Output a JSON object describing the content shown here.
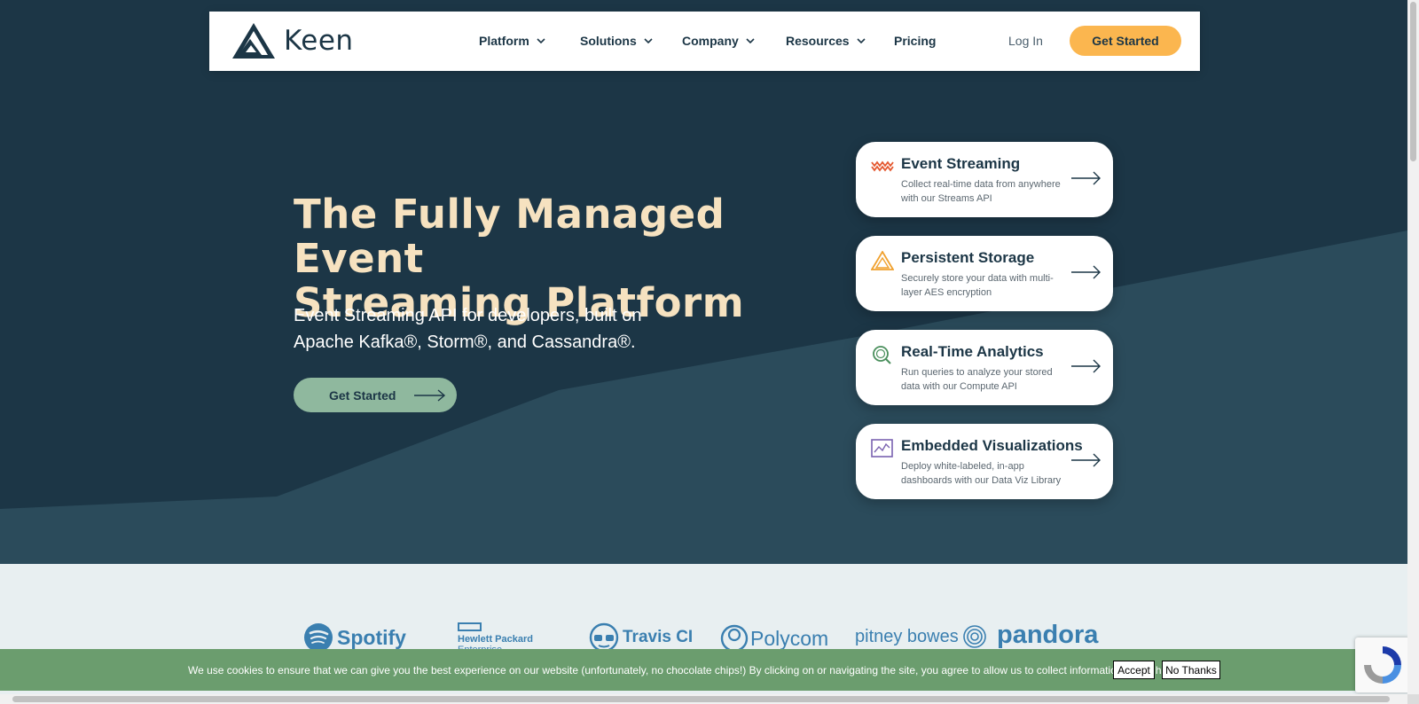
{
  "brand": {
    "name": "Keen",
    "logo_color": "#1c3646"
  },
  "nav": {
    "items": [
      {
        "label": "Platform",
        "has_dropdown": true
      },
      {
        "label": "Solutions",
        "has_dropdown": true
      },
      {
        "label": "Company",
        "has_dropdown": true
      },
      {
        "label": "Resources",
        "has_dropdown": true
      },
      {
        "label": "Pricing",
        "has_dropdown": false
      }
    ],
    "login_label": "Log In",
    "cta_label": "Get Started"
  },
  "hero": {
    "title_line1": "The Fully Managed Event",
    "title_line2": "Streaming Platform",
    "subtitle_line1": "Event Streaming API for developers, built on",
    "subtitle_line2": "Apache Kafka®, Storm®, and Cassandra®.",
    "cta_label": "Get Started"
  },
  "features": [
    {
      "title": "Event Streaming",
      "desc_line1": "Collect real-time data from anywhere",
      "desc_line2": "with our Streams API",
      "icon": "waves-icon"
    },
    {
      "title": "Persistent Storage",
      "desc_line1": "Securely store your data with multi-",
      "desc_line2": "layer AES encryption",
      "icon": "storage-triangle-icon"
    },
    {
      "title": "Real-Time Analytics",
      "desc_line1": "Run queries to analyze your stored",
      "desc_line2": "data with our Compute API",
      "icon": "magnifier-icon"
    },
    {
      "title": "Embedded Visualizations",
      "desc_line1": "Deploy white-labeled, in-app",
      "desc_line2": "dashboards with our Data Viz Library",
      "icon": "chart-icon"
    }
  ],
  "customers": {
    "spotify": "Spotify",
    "hpe_line1": "Hewlett Packard",
    "hpe_line2": "Enterprise",
    "travis": "Travis CI",
    "polycom": "Polycom",
    "pitney": "pitney bowes",
    "pandora": "pandora"
  },
  "cookie": {
    "text": "We use cookies to ensure that we can give you the best experience on our website (unfortunately, no chocolate chips!) By clicking on or navigating the site, you agree to allow us to collect information through cookies.",
    "accept_label": "Accept",
    "decline_label": "No Thanks",
    "close_label": "×"
  },
  "colors": {
    "hero_bg": "#1c3646",
    "accent_orange": "#fbb64f",
    "accent_green": "#8fb89e",
    "title_cream": "#f6e2c0",
    "cookie_bar": "#6b9d6e"
  }
}
